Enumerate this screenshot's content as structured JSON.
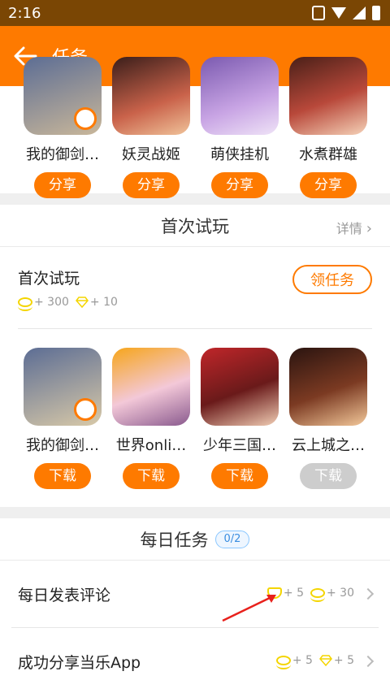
{
  "status": {
    "time": "2:16"
  },
  "header": {
    "title": "任务"
  },
  "share_section": {
    "games": [
      {
        "name": "我的御剑…",
        "button": "分享"
      },
      {
        "name": "妖灵战姬",
        "button": "分享"
      },
      {
        "name": "萌侠挂机",
        "button": "分享"
      },
      {
        "name": "水煮群雄",
        "button": "分享"
      }
    ]
  },
  "trial_section": {
    "title": "首次试玩",
    "detail": "详情",
    "task": {
      "name": "首次试玩",
      "coins": "+ 300",
      "diamonds": "+ 10",
      "button": "领任务"
    },
    "games": [
      {
        "name": "我的御剑…",
        "button": "下载"
      },
      {
        "name": "世界onli…",
        "button": "下载"
      },
      {
        "name": "少年三国…",
        "button": "下载"
      },
      {
        "name": "云上城之…",
        "button": "下载"
      }
    ]
  },
  "daily_section": {
    "title": "每日任务",
    "progress": "0/2",
    "tasks": [
      {
        "name": "每日发表评论",
        "reward1": "+ 5",
        "reward2": "+ 30"
      },
      {
        "name": "成功分享当乐App",
        "reward1": "+ 5",
        "reward2": "+ 5"
      }
    ]
  },
  "colors": {
    "accent": "#fe7a00",
    "status_bar": "#7a4604",
    "coin": "#f4d500",
    "arrow": "#e8211c"
  }
}
